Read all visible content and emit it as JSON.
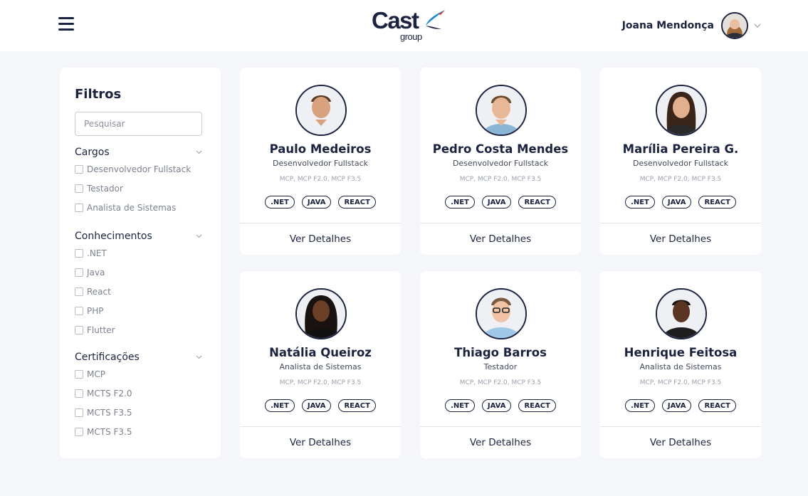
{
  "header": {
    "logo": {
      "brand": "Cast",
      "sub": "group"
    },
    "user_name": "Joana Mendonça"
  },
  "filters": {
    "title": "Filtros",
    "search_placeholder": "Pesquisar",
    "groups": [
      {
        "title": "Cargos",
        "options": [
          "Desenvolvedor Fullstack",
          "Testador",
          "Analista de Sistemas"
        ]
      },
      {
        "title": "Conhecimentos",
        "options": [
          ".NET",
          "Java",
          "React",
          "PHP",
          "Flutter"
        ]
      },
      {
        "title": "Certificações",
        "options": [
          "MCP",
          "MCTS F2.0",
          "MCTS F3.5",
          "MCTS F3.5"
        ]
      }
    ]
  },
  "cards": [
    {
      "name": "Paulo Medeiros",
      "role": "Desenvolvedor Fullstack",
      "certs": "MCP, MCP F2.0, MCP F3.5",
      "tags": [
        ".NET",
        "JAVA",
        "REACT"
      ],
      "action": "Ver Detalhes"
    },
    {
      "name": "Pedro Costa Mendes",
      "role": "Desenvolvedor Fullstack",
      "certs": "MCP, MCP F2.0, MCP F3.5",
      "tags": [
        ".NET",
        "JAVA",
        "REACT"
      ],
      "action": "Ver Detalhes"
    },
    {
      "name": "Marília Pereira G.",
      "role": "Desenvolvedor Fullstack",
      "certs": "MCP, MCP F2.0, MCP F3.5",
      "tags": [
        ".NET",
        "JAVA",
        "REACT"
      ],
      "action": "Ver Detalhes"
    },
    {
      "name": "Natália Queiroz",
      "role": "Analista de Sistemas",
      "certs": "MCP, MCP F2.0, MCP F3.5",
      "tags": [
        ".NET",
        "JAVA",
        "REACT"
      ],
      "action": "Ver Detalhes"
    },
    {
      "name": "Thiago Barros",
      "role": "Testador",
      "certs": "MCP, MCP F2.0, MCP F3.5",
      "tags": [
        ".NET",
        "JAVA",
        "REACT"
      ],
      "action": "Ver Detalhes"
    },
    {
      "name": "Henrique Feitosa",
      "role": "Analista de Sistemas",
      "certs": "MCP, MCP F2.0, MCP F3.5",
      "tags": [
        ".NET",
        "JAVA",
        "REACT"
      ],
      "action": "Ver Detalhes"
    }
  ],
  "colors": {
    "navy": "#1c2340",
    "logo_accent": "#1e88d6",
    "page_bg": "#f5f6fa"
  }
}
